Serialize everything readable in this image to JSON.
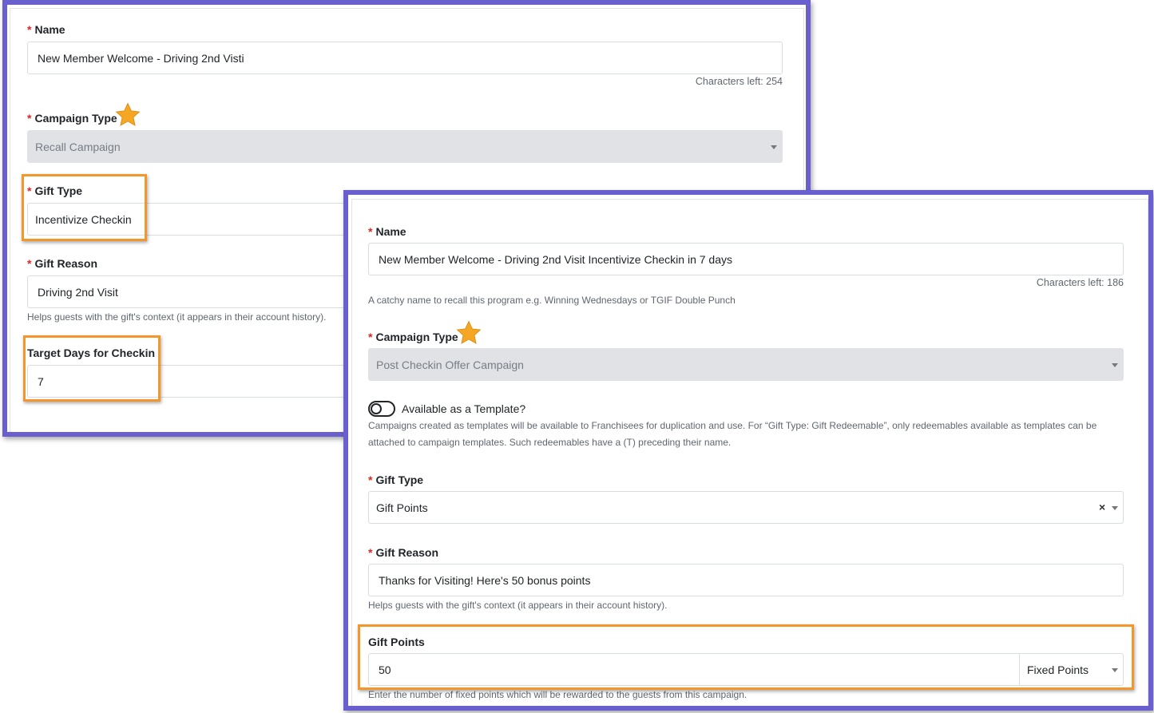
{
  "colors": {
    "frame": "#6a5fcf",
    "highlight": "#f3962b",
    "required": "#e02424",
    "star": "#f5a623"
  },
  "back_form": {
    "name_label": "Name",
    "name_value": "New Member Welcome - Driving 2nd Visti",
    "name_chars_left": "Characters left: 254",
    "campaign_type_label": "Campaign Type",
    "campaign_type_value": "Recall Campaign",
    "gift_type_label": "Gift Type",
    "gift_type_value": "Incentivize Checkin",
    "gift_reason_label": "Gift Reason",
    "gift_reason_value": "Driving 2nd Visit",
    "gift_reason_help": "Helps guests with the gift's context (it appears in their account history).",
    "target_days_label": "Target Days for Checkin",
    "target_days_value": "7"
  },
  "front_form": {
    "name_label": "Name",
    "name_value": "New Member Welcome - Driving 2nd Visit Incentivize Checkin in 7 days",
    "name_chars_left": "Characters left: 186",
    "name_help": "A catchy name to recall this program e.g. Winning Wednesdays or TGIF Double Punch",
    "campaign_type_label": "Campaign Type",
    "campaign_type_value": "Post Checkin Offer Campaign",
    "template_toggle_label": "Available as a Template?",
    "template_toggle_on": false,
    "template_help_line1": "Campaigns created as templates will be available to Franchisees for duplication and use. For “Gift Type: Gift Redeemable”, only redeemables available as templates can be",
    "template_help_line2": "attached to campaign templates. Such redeemables have a (T) preceding their name.",
    "gift_type_label": "Gift Type",
    "gift_type_value": "Gift Points",
    "gift_type_clear": "×",
    "gift_reason_label": "Gift Reason",
    "gift_reason_value": "Thanks for Visiting! Here's 50 bonus points",
    "gift_reason_help": "Helps guests with the gift's context (it appears in their account history).",
    "gift_points_label": "Gift Points",
    "gift_points_value": "50",
    "gift_points_mode": "Fixed Points",
    "gift_points_help": "Enter the number of fixed points which will be rewarded to the guests from this campaign."
  }
}
